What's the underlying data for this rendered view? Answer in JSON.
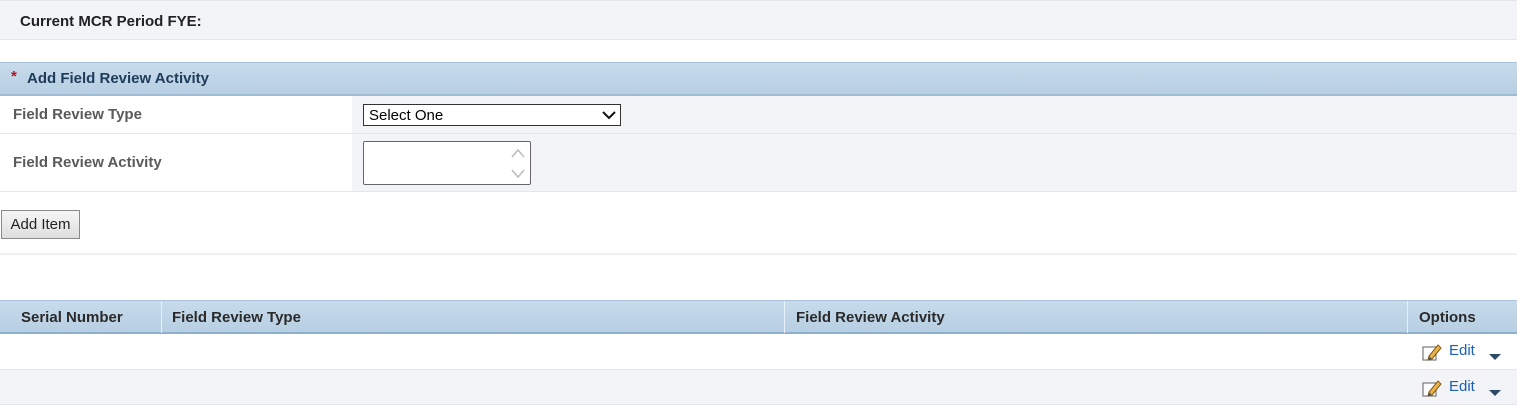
{
  "mcr": {
    "period_label": "Current MCR Period FYE:"
  },
  "form": {
    "section_title": "Add Field Review Activity",
    "required_marker": "*",
    "field_review_type_label": "Field Review Type",
    "field_review_type_value": "Select One",
    "field_review_activity_label": "Field Review Activity",
    "field_review_activity_value": "",
    "add_button_label": "Add Item"
  },
  "grid": {
    "columns": [
      "Serial Number",
      "Field Review Type",
      "Field Review Activity",
      "Options"
    ],
    "rows": [
      {
        "serial": "",
        "type": "",
        "activity": "",
        "edit_label": "Edit"
      },
      {
        "serial": "",
        "type": "",
        "activity": "",
        "edit_label": "Edit"
      }
    ]
  },
  "colors": {
    "header_bg": "#bfd5e8",
    "header_text": "#1d3c5a",
    "required_star": "#b2131d",
    "link": "#1a5fb4",
    "row_alt": "#f2f4f7"
  },
  "icons": {
    "row_edit": "pencil-edit-icon",
    "row_menu": "caret-down-icon"
  }
}
